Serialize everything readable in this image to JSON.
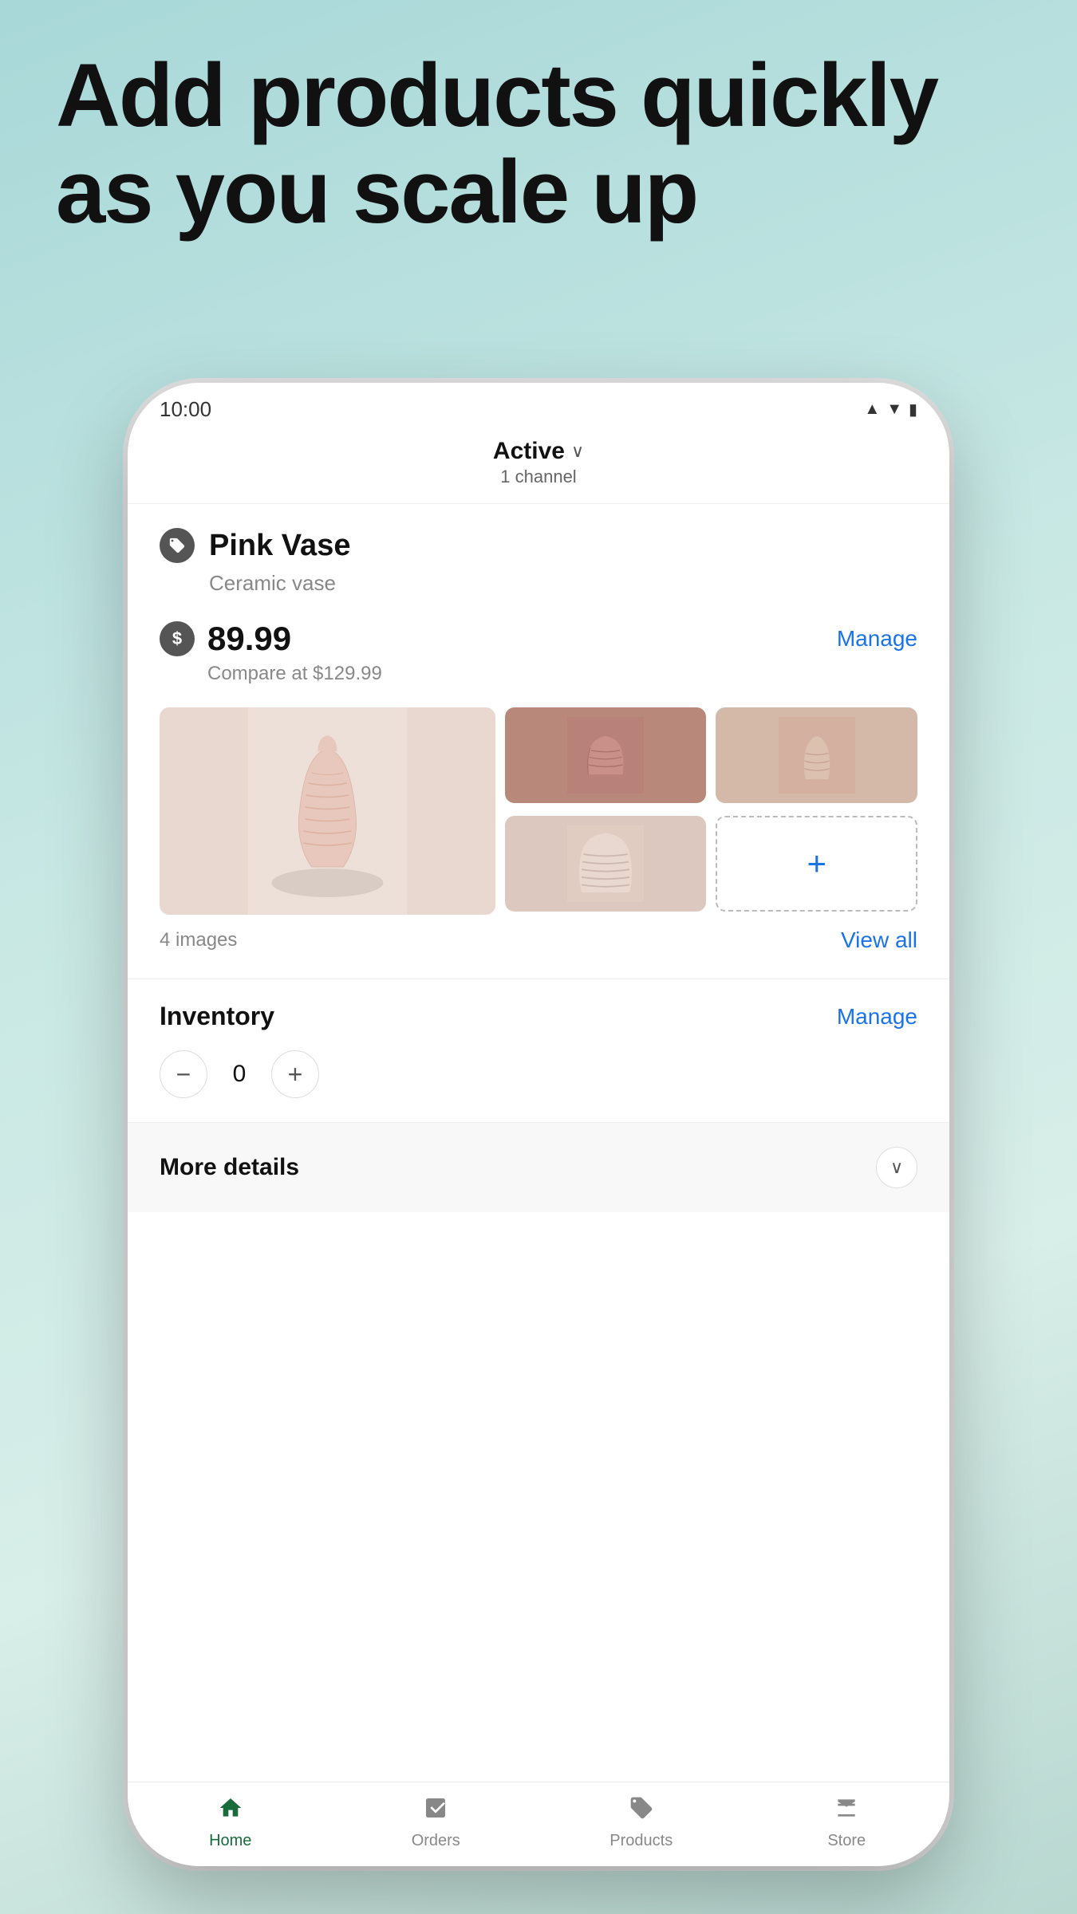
{
  "hero": {
    "title": "Add products quickly as you scale up"
  },
  "status_bar": {
    "time": "10:00",
    "icons": "▲▼▲"
  },
  "header": {
    "status": "Active",
    "channel_count": "1 channel",
    "chevron": "∨"
  },
  "product": {
    "name": "Pink Vase",
    "description": "Ceramic vase",
    "price": "89.99",
    "compare_price": "Compare at $129.99",
    "manage_label": "Manage",
    "image_count": "4 images",
    "view_all_label": "View all"
  },
  "inventory": {
    "label": "Inventory",
    "manage_label": "Manage",
    "quantity": "0",
    "decrement_label": "−",
    "increment_label": "+"
  },
  "more_details": {
    "label": "More details"
  },
  "nav": {
    "items": [
      {
        "id": "home",
        "label": "Home",
        "active": true
      },
      {
        "id": "orders",
        "label": "Orders",
        "active": false
      },
      {
        "id": "products",
        "label": "Products",
        "active": false
      },
      {
        "id": "store",
        "label": "Store",
        "active": false
      }
    ]
  }
}
